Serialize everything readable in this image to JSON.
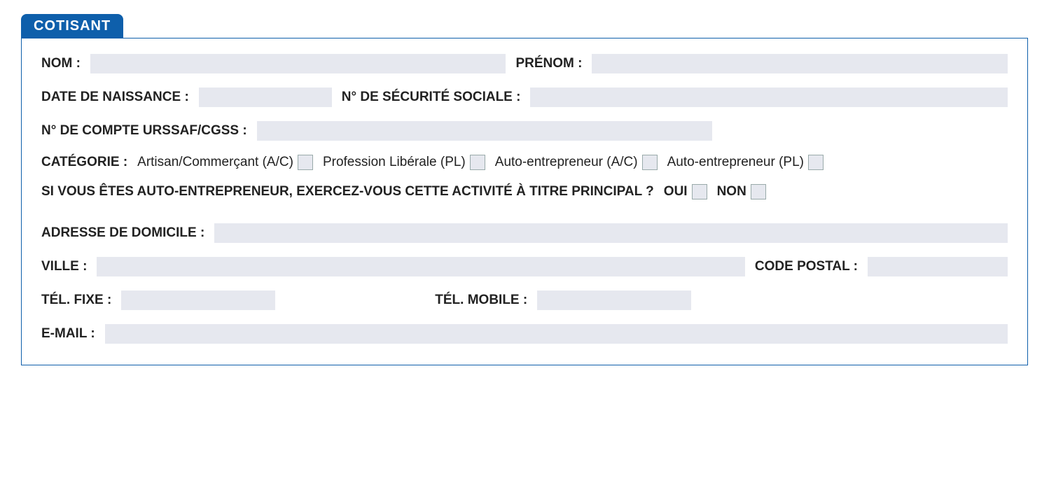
{
  "title": "COTISANT",
  "labels": {
    "nom": "NOM :",
    "prenom": "PRÉNOM :",
    "dob": "DATE DE NAISSANCE :",
    "ssn": "N° DE SÉCURITÉ SOCIALE :",
    "urssaf": "N° DE COMPTE URSSAF/CGSS :",
    "categorie": "CATÉGORIE :",
    "auto_q": "SI VOUS ÊTES AUTO-ENTREPRENEUR, EXERCEZ-VOUS CETTE ACTIVITÉ À TITRE PRINCIPAL ?",
    "adresse": "ADRESSE DE DOMICILE :",
    "ville": "VILLE :",
    "cp": "CODE POSTAL :",
    "tel_fixe": "TÉL. FIXE :",
    "tel_mobile": "TÉL. MOBILE :",
    "email": "E-MAIL :"
  },
  "categorie_options": {
    "a": "Artisan/Commerçant (A/C)",
    "b": "Profession Libérale (PL)",
    "c": "Auto-entrepreneur (A/C)",
    "d": "Auto-entrepreneur (PL)"
  },
  "yesno": {
    "oui": "OUI",
    "non": "NON"
  },
  "values": {
    "nom": "",
    "prenom": "",
    "dob": "",
    "ssn": "",
    "urssaf": "",
    "adresse": "",
    "ville": "",
    "cp": "",
    "tel_fixe": "",
    "tel_mobile": "",
    "email": ""
  }
}
